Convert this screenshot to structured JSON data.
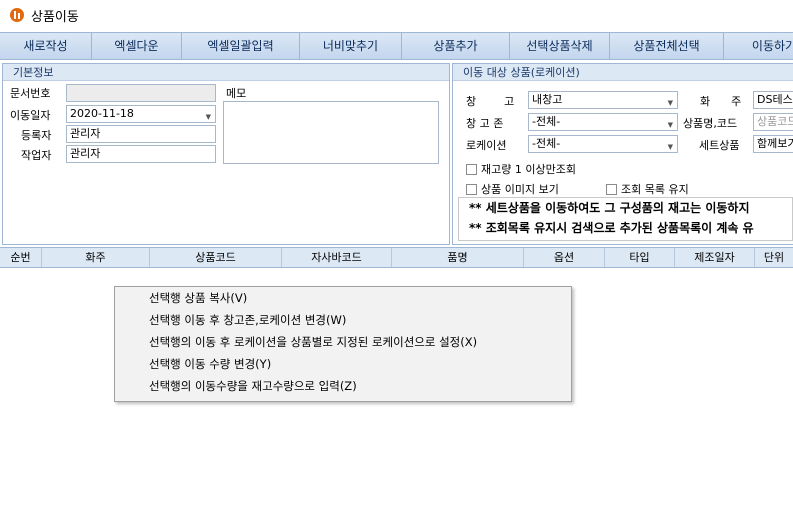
{
  "window": {
    "title": "상품이동"
  },
  "toolbar": [
    "새로작성",
    "엑셀다운",
    "엑셀일괄입력",
    "너비맞추기",
    "상품추가",
    "선택상품삭제",
    "상품전체선택",
    "이동하기"
  ],
  "basic_info": {
    "header": "기본정보",
    "doc_no_label": "문서번호",
    "doc_no_value": "",
    "move_date_label": "이동일자",
    "move_date_value": "2020-11-18",
    "registrant_label": "등록자",
    "registrant_value": "관리자",
    "worker_label": "작업자",
    "worker_value": "관리자",
    "memo_label": "메모"
  },
  "target": {
    "header": "이동 대상 상품(로케이션)",
    "warehouse_label": "창        고",
    "warehouse_value": "내창고",
    "shipper_label": "화      주",
    "shipper_value": "DS테스트",
    "zone_label": "창 고 존",
    "zone_value": "-전체-",
    "product_label": "상품명,코드",
    "product_placeholder": "상품코드",
    "location_label": "로케이션",
    "location_value": "-전체-",
    "set_label": "세트상품",
    "set_value": "함께보기",
    "cb_stock": "재고량 1 이상만조회",
    "cb_image": "상품 이미지 보기",
    "cb_keep": "조회 목록 유지",
    "notice1": "** 세트상품을 이동하여도 그 구성품의 재고는 이동하지",
    "notice2": "** 조회목록 유지시 검색으로 추가된 상품목록이 계속 유"
  },
  "grid": {
    "columns": [
      "순번",
      "화주",
      "상품코드",
      "자사바코드",
      "품명",
      "옵션",
      "타입",
      "제조일자",
      "단위"
    ]
  },
  "context_menu": [
    "선택행 상품 복사(V)",
    "선택행 이동 후 창고존,로케이션 변경(W)",
    "선택행의 이동 후 로케이션을 상품별로 지정된 로케이션으로 설정(X)",
    "선택행 이동 수량 변경(Y)",
    "선택행의 이동수량을 재고수량으로 입력(Z)"
  ],
  "colors": {
    "accent": "#dde8f5",
    "toolbar_text": "#0a2a5a",
    "icon": "#e06a10"
  }
}
